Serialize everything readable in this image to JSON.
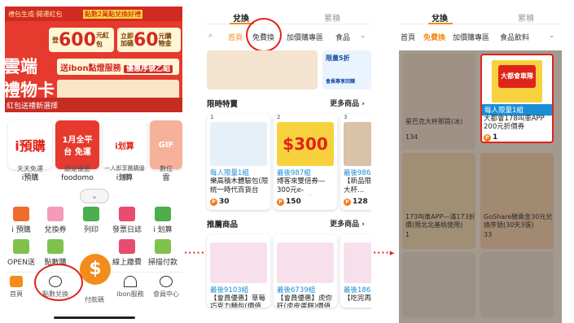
{
  "screen1": {
    "banner": {
      "top_left": "禮包生成·開運紅包",
      "top_mid": "點數2萬點兌換好禮",
      "coupon1_prefix": "登",
      "coupon1_value": "600",
      "coupon1_unit": "元紅包",
      "coupon2_label": "立即加碼",
      "coupon2_value": "60",
      "coupon2_unit": "元購物金",
      "cloud_title": "雲端\n禮物卡",
      "ibon_text": "送ibon點燈服務",
      "ibon_badge": "優惠序號乙組",
      "bottom_text": "紅包送禮新選擇"
    },
    "categories": [
      {
        "label": "i預購",
        "sub": "天天免運",
        "name": "i預購"
      },
      {
        "label": "1月全平台 免運",
        "sub": "跟定優惠",
        "name": "foodomo"
      },
      {
        "label": "i划算",
        "sub": "一人即享團購優惠",
        "name": "i划算"
      },
      {
        "label": "GIF",
        "sub": "數位",
        "name": "雲"
      }
    ],
    "expand_icon": "chevron-down-icon",
    "icons_row1": [
      "i 預購",
      "兌換券",
      "列印",
      "發票日誌",
      "i 划算"
    ],
    "icons_row2": [
      "OPEN送",
      "點數購",
      "",
      "線上繳費",
      "掃描付款"
    ],
    "nav": [
      "首頁",
      "點數兌換",
      "付款碼",
      "ibon服務",
      "會員中心"
    ],
    "pay_symbol": "$"
  },
  "screen2": {
    "tabs": [
      "兌換",
      "累積"
    ],
    "subtabs": [
      "首頁",
      "免費換",
      "加價購專區",
      "食品"
    ],
    "section1_title": "限時特賣",
    "section1_more": "更多商品 ›",
    "products": [
      {
        "idx": "1",
        "tag": "每人限量1組",
        "title": "樂高積木體驗包(限統一時代百貨台北...",
        "points": "30"
      },
      {
        "idx": "2",
        "tag": "最後987組",
        "title": "博客來雙倍券—300元e-Coupon(滿...",
        "points": "150",
        "img_text": "$300"
      },
      {
        "idx": "3",
        "tag": "最後986組",
        "title": "【新品限時】巴克大杯...",
        "points": "128"
      }
    ],
    "section2_title": "推薦商品",
    "section2_more": "更多商品 ›",
    "products2": [
      {
        "idx": "1",
        "tag": "最後9103組",
        "title": "【會員優惠】草莓巧克力麵包(價值30元)"
      },
      {
        "idx": "2",
        "tag": "最後6739組",
        "title": "【會員優惠】虎你旺(虎皮蛋糕)價值4..."
      },
      {
        "idx": "3",
        "tag": "最後1861組",
        "title": "【吃完再說】..."
      }
    ],
    "promo_text1": "限量5折",
    "promo_text2": "會員專享回饋"
  },
  "screen3": {
    "tabs": [
      "兌換",
      "累積"
    ],
    "subtabs": [
      "首頁",
      "免費換",
      "加價購專區",
      "食品飲料"
    ],
    "highlight": {
      "brand": "大都會車隊",
      "tag": "每人限量1組",
      "title": "大都會178叫車APP 200元折價券",
      "points": "1"
    },
    "cards": [
      {
        "title": "星巴克大杯那提(冰)",
        "points": "134"
      },
      {
        "title": "173叫車APP—滿173折價(限北北基桃使用)",
        "points": "1"
      },
      {
        "title": "GoShare騎乘金30元兌換序號(30天3張)",
        "points": "33"
      }
    ]
  },
  "colors": {
    "accent": "#f28c1a",
    "red": "#e0241b",
    "blue": "#1a8fd6"
  }
}
